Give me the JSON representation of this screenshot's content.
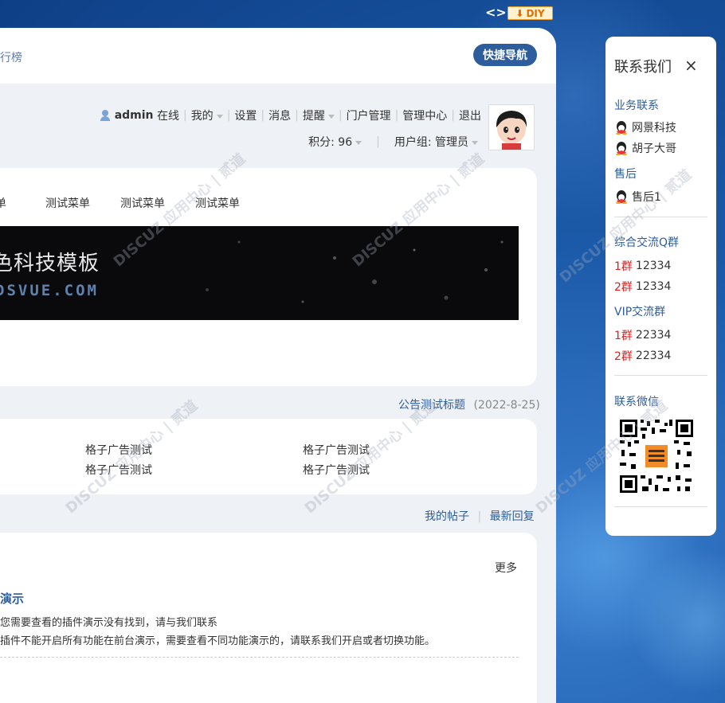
{
  "topbar": {
    "diy_toggle": "<>",
    "diy_label": "DIY"
  },
  "nav": {
    "partial_link": "行榜",
    "quick_nav": "快捷导航"
  },
  "user": {
    "username": "admin",
    "status": "在线",
    "my": "我的",
    "settings": "设置",
    "messages": "消息",
    "reminder": "提醒",
    "portal_admin": "门户管理",
    "admin_center": "管理中心",
    "logout": "退出",
    "points": "积分: 96",
    "group": "用户组: 管理员"
  },
  "menu": {
    "items": [
      "菜单",
      "测试菜单",
      "测试菜单",
      "测试菜单"
    ]
  },
  "banner": {
    "title": "色科技模板",
    "subtitle": "DSVUE.COM"
  },
  "notice": {
    "title": "公告测试标题",
    "date": "(2022-8-25)"
  },
  "ads": {
    "items": [
      "格子广告测试",
      "格子广告测试",
      "格子广告测试",
      "格子广告测试"
    ]
  },
  "tabs": {
    "my_posts": "我的帖子",
    "latest_reply": "最新回复"
  },
  "post": {
    "more": "更多",
    "title": "演示",
    "line1": "您需要查看的插件演示没有找到，请与我们联系",
    "line2": "插件不能开启所有功能在前台演示，需要查看不同功能演示的，请联系我们开启或者切换功能。"
  },
  "contact": {
    "title": "联系我们",
    "close": "×",
    "business_head": "业务联系",
    "business": [
      "网景科技",
      "胡子大哥"
    ],
    "after_head": "售后",
    "after": [
      "售后1"
    ],
    "qgroup_head": "综合交流Q群",
    "qgroups": [
      {
        "label": "1群",
        "num": "12334"
      },
      {
        "label": "2群",
        "num": "12334"
      }
    ],
    "vip_head": "VIP交流群",
    "vips": [
      {
        "label": "1群",
        "num": "22334"
      },
      {
        "label": "2群",
        "num": "22334"
      }
    ],
    "wechat_head": "联系微信"
  },
  "colors": {
    "accent": "#2d5d9c",
    "red": "#e02020",
    "diy": "#e66a00"
  }
}
